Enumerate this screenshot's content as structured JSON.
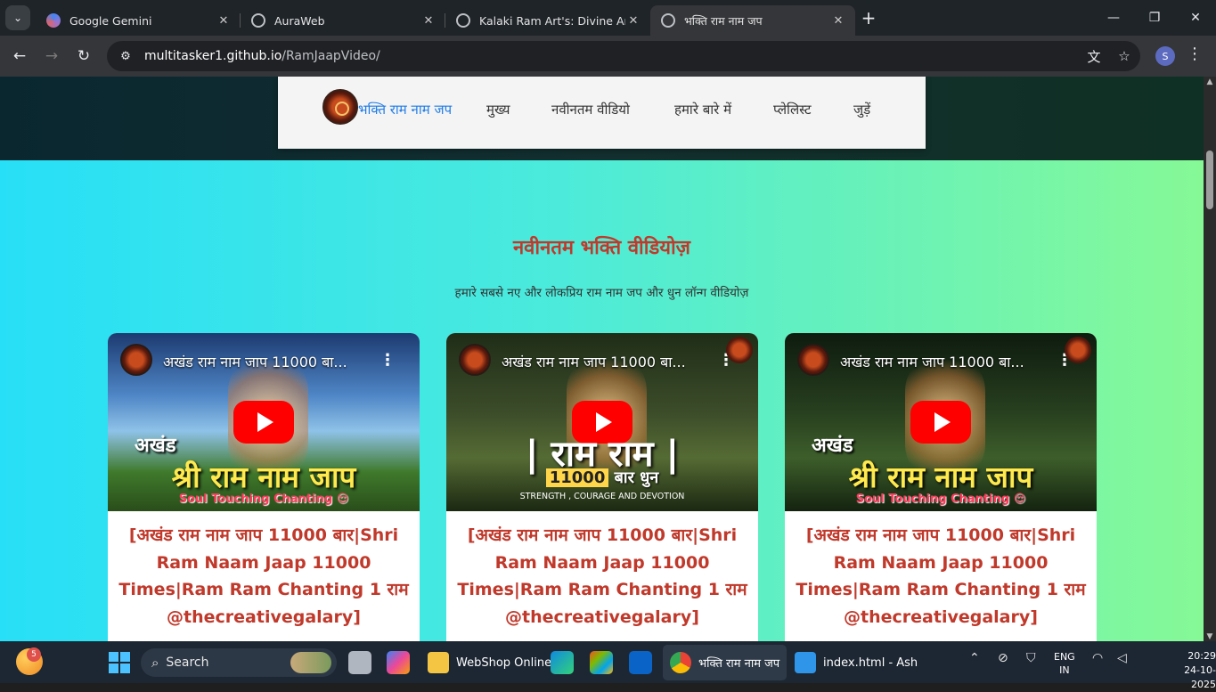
{
  "browser": {
    "tabs": [
      {
        "title": "Google Gemini",
        "favicon_color": "#4285f4"
      },
      {
        "title": "AuraWeb",
        "favicon_color": "#9aa0a6"
      },
      {
        "title": "Kalaki Ram Art's: Divine Art by A",
        "favicon_color": "#9aa0a6"
      },
      {
        "title": "भक्ति राम नाम जप",
        "favicon_color": "#9aa0a6"
      }
    ],
    "url_host": "multitasker1.github.io",
    "url_path": "/RamJaapVideo/",
    "profile_initial": "S"
  },
  "site": {
    "brand": "भक्ति राम नाम जप",
    "nav": [
      "मुख्य",
      "नवीनतम वीडियो",
      "हमारे बारे में",
      "प्लेलिस्ट",
      "जुड़ें"
    ],
    "section_title": "नवीनतम भक्ति वीडियोज़",
    "section_subtitle": "हमारे सबसे नए और लोकप्रिय राम नाम जप और धुन लॉन्ग वीडियोज़"
  },
  "videos": [
    {
      "embed_title": "अखंड राम नाम जाप 11000 बा...",
      "overlay_small": "अखंड",
      "overlay_big": "श्री राम नाम जाप",
      "overlay_tag": "Soul Touching Chanting 😌",
      "title": "[अखंड राम नाम जाप 11000 बार|Shri Ram Naam Jaap 11000 Times|Ram Ram Chanting 1 राम @thecreativegalary]"
    },
    {
      "embed_title": "अखंड राम नाम जाप 11000 बा...",
      "overlay_big": "| राम राम |",
      "overlay_count_num": "11000",
      "overlay_count_word": "बार",
      "overlay_count_tail": "धुन",
      "overlay_tag": "STRENGTH , COURAGE AND DEVOTION",
      "title": "[अखंड राम नाम जाप 11000 बार|Shri Ram Naam Jaap 11000 Times|Ram Ram Chanting 1 राम @thecreativegalary]"
    },
    {
      "embed_title": "अखंड राम नाम जाप 11000 बा...",
      "overlay_small": "अखंड",
      "overlay_big": "श्री राम नाम जाप",
      "overlay_tag": "Soul Touching Chanting 😌",
      "title": "[अखंड राम नाम जाप 11000 बार|Shri Ram Naam Jaap 11000 Times|Ram Ram Chanting 1 राम @thecreativegalary]"
    }
  ],
  "taskbar": {
    "widget_badge": "5",
    "search_label": "Search",
    "apps": [
      {
        "label": "WebShop Online"
      },
      {
        "label": "भक्ति राम नाम जप"
      },
      {
        "label": "index.html - Ash"
      }
    ],
    "lang_line1": "ENG",
    "lang_line2": "IN",
    "time": "20:29",
    "date": "24-10-2025"
  },
  "icons": {
    "tab_close": "close-icon",
    "new_tab": "plus-icon",
    "back": "back-arrow-icon",
    "forward": "forward-arrow-icon",
    "reload": "reload-icon",
    "site_info": "tune-icon",
    "translate": "translate-icon",
    "bookmark": "star-icon",
    "menu": "more-vert-icon"
  },
  "colors": {
    "section_title": "#c0392b",
    "brand_link": "#1e7be6",
    "yt_red": "#ff0000",
    "gradient_left": "#27dff7",
    "gradient_right": "#86f996"
  }
}
